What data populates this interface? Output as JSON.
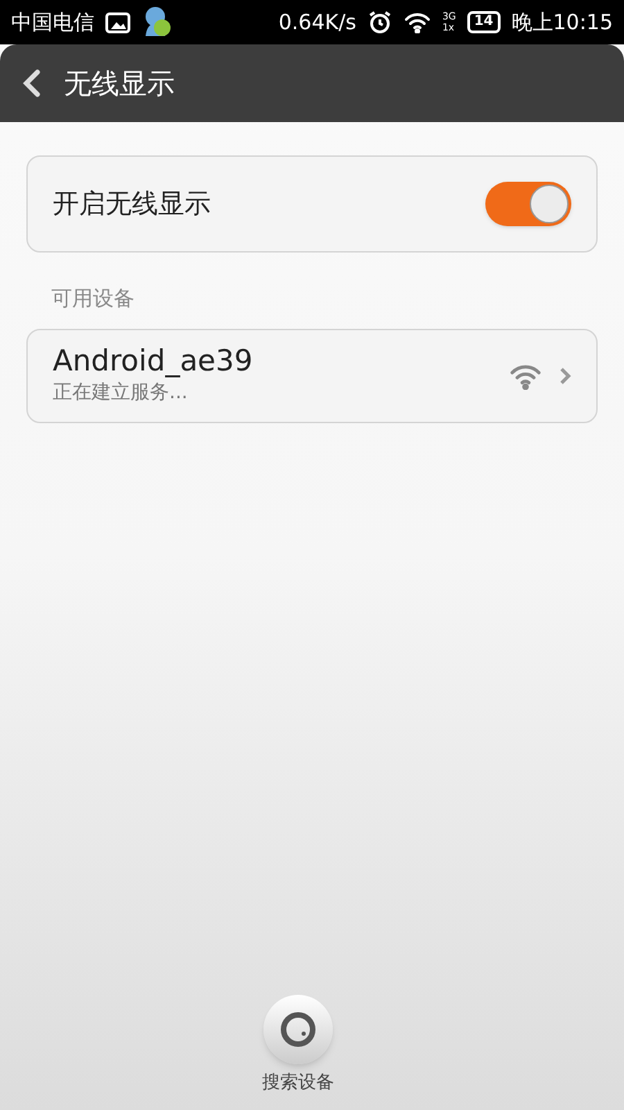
{
  "status_bar": {
    "carrier": "中国电信",
    "speed": "0.64K/s",
    "network_top": "3G",
    "network_bottom": "1x",
    "battery": "14",
    "time": "晚上10:15"
  },
  "header": {
    "title": "无线显示"
  },
  "toggle_row": {
    "label": "开启无线显示",
    "on": true
  },
  "section_label": "可用设备",
  "devices": [
    {
      "name": "Android_ae39",
      "status": "正在建立服务..."
    }
  ],
  "search_button": {
    "label": "搜索设备"
  }
}
